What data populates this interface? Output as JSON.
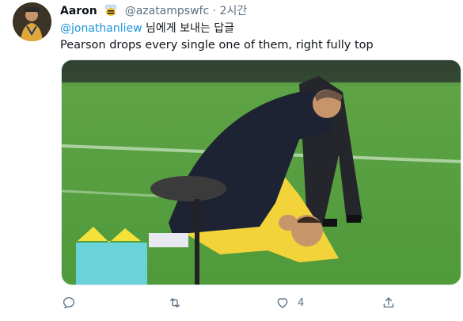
{
  "tweet": {
    "author_name": "Aaron",
    "handle": "@azatampswfc",
    "separator": "·",
    "time": "2시간",
    "reply_mention": "@jonathanliew",
    "reply_suffix": " 님에게 보내는 답글",
    "text": "Pearson drops every single one of them, right fully top"
  },
  "actions": {
    "reply_count": "",
    "retweet_count": "",
    "like_count": "4",
    "share_count": ""
  },
  "colors": {
    "accent": "#1b95e0",
    "secondary_text": "#5b7083",
    "pitch_green": "#4f9a3a"
  },
  "icons": [
    "bee-emoji-icon",
    "reply-icon",
    "retweet-icon",
    "like-icon",
    "share-icon"
  ]
}
